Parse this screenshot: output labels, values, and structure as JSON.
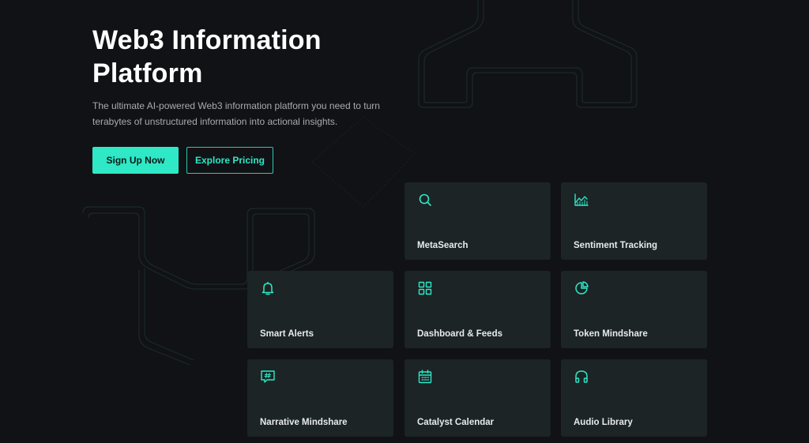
{
  "hero": {
    "title_line1": "Web3 Information",
    "title_line2": "Platform",
    "subtitle_line1": "The ultimate AI-powered Web3 information platform you need to turn",
    "subtitle_line2": "terabytes of unstructured information into actional insights."
  },
  "buttons": {
    "signup_label": "Sign Up Now",
    "pricing_label": "Explore Pricing"
  },
  "features": [
    {
      "label": "MetaSearch",
      "icon": "search-icon"
    },
    {
      "label": "Sentiment Tracking",
      "icon": "chart-trend-icon"
    },
    {
      "label": "Smart Alerts",
      "icon": "bell-icon"
    },
    {
      "label": "Dashboard & Feeds",
      "icon": "dashboard-grid-icon"
    },
    {
      "label": "Token Mindshare",
      "icon": "pie-chart-icon"
    },
    {
      "label": "Narrative Mindshare",
      "icon": "hashtag-message-icon"
    },
    {
      "label": "Catalyst Calendar",
      "icon": "calendar-icon"
    },
    {
      "label": "Audio Library",
      "icon": "headphones-icon"
    }
  ],
  "colors": {
    "background": "#111215",
    "accent": "#2ee8c6",
    "card": "#1c2425",
    "muted_text": "#a8abb0"
  }
}
